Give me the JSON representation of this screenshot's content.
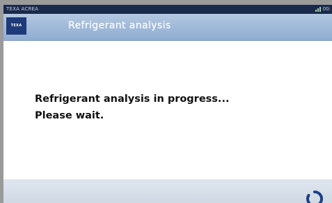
{
  "status_bar": {
    "app_name": "TEXA ACREA",
    "time": "00:",
    "signal_icon": "signal-icon"
  },
  "header": {
    "logo_text": "TEXA",
    "title": "Refrigerant analysis"
  },
  "message": {
    "line1": "Refrigerant analysis in progress...",
    "line2": "Please wait."
  },
  "footer": {
    "spinner_icon": "loading-spinner-icon"
  },
  "colors": {
    "header": "#9fb8d8",
    "status_bar": "#1a2a4a",
    "logo": "#1e3a78",
    "spinner": "#1d3f86"
  }
}
